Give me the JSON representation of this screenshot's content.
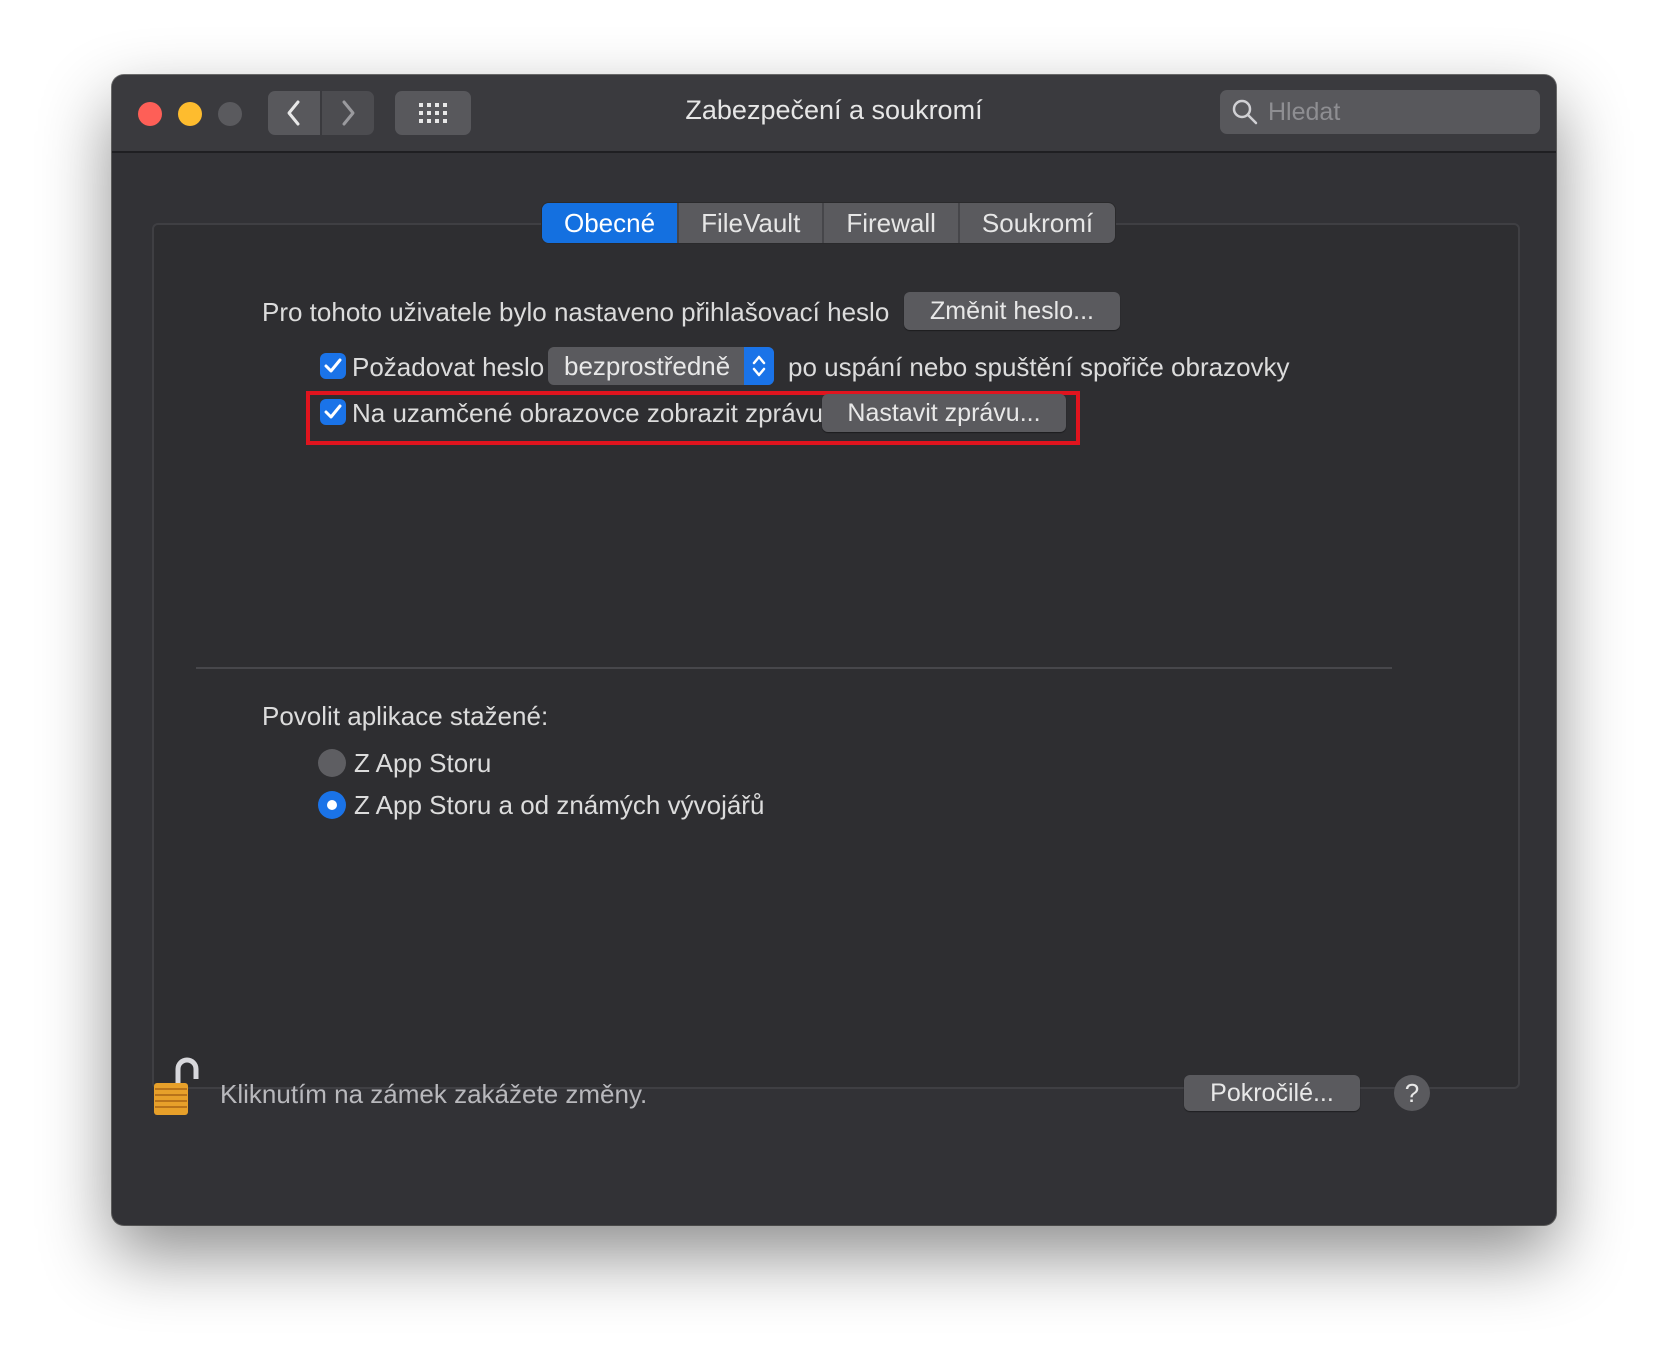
{
  "window": {
    "title": "Zabezpečení a soukromí",
    "search_placeholder": "Hledat"
  },
  "tabs": [
    {
      "label": "Obecné",
      "active": true
    },
    {
      "label": "FileVault",
      "active": false
    },
    {
      "label": "Firewall",
      "active": false
    },
    {
      "label": "Soukromí",
      "active": false
    }
  ],
  "general": {
    "password_text": "Pro tohoto uživatele bylo nastaveno přihlašovací heslo",
    "change_password_button": "Změnit heslo...",
    "require_password_label": "Požadovat heslo",
    "require_password_checked": true,
    "require_password_value": "bezprostředně",
    "require_password_suffix": "po uspání nebo spuštění spořiče obrazovky",
    "lock_message_label": "Na uzamčené obrazovce zobrazit zprávu",
    "lock_message_checked": true,
    "set_message_button": "Nastavit zprávu..."
  },
  "apps": {
    "heading": "Povolit aplikace stažené:",
    "options": [
      {
        "label": "Z App Storu",
        "selected": false
      },
      {
        "label": "Z App Storu a od známých vývojářů",
        "selected": true
      }
    ]
  },
  "footer": {
    "lock_text": "Kliknutím na zámek zakážete změny.",
    "advanced_button": "Pokročilé...",
    "help_button": "?"
  },
  "colors": {
    "accent": "#1a73e8",
    "highlight_border": "#e0141e",
    "window_bg": "#323236"
  }
}
